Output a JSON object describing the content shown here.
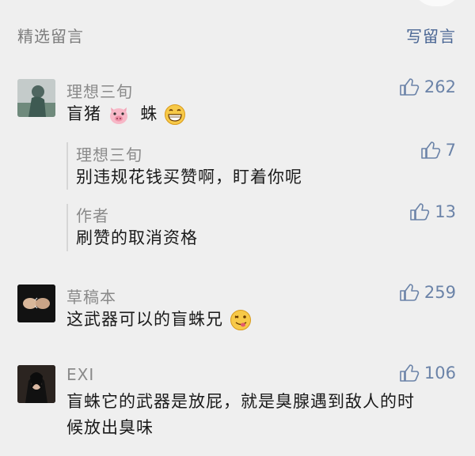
{
  "header": {
    "title": "精选留言",
    "write_label": "写留言"
  },
  "comments": [
    {
      "author": "理想三旬",
      "text_a": "盲猪",
      "text_b": "蛛",
      "likes": "262",
      "replies": [
        {
          "author": "理想三旬",
          "text": "别违规花钱买赞啊，盯着你呢",
          "likes": "7"
        },
        {
          "author": "作者",
          "text": "刷赞的取消资格",
          "likes": "13"
        }
      ]
    },
    {
      "author": "草稿本",
      "text": "这武器可以的盲蛛兄",
      "likes": "259"
    },
    {
      "author": "EXI",
      "text_line1": "盲蛛它的武器是放屁，就是臭腺遇到敌人的时",
      "text_line2": "候放出臭味",
      "likes": "106"
    }
  ],
  "icons": [
    "thumbs-up-icon",
    "pig-face-emoji",
    "grin-emoji",
    "wink-tongue-emoji"
  ],
  "colors": {
    "link": "#4a6694",
    "like": "#6b83a8",
    "background": "#efefef"
  }
}
